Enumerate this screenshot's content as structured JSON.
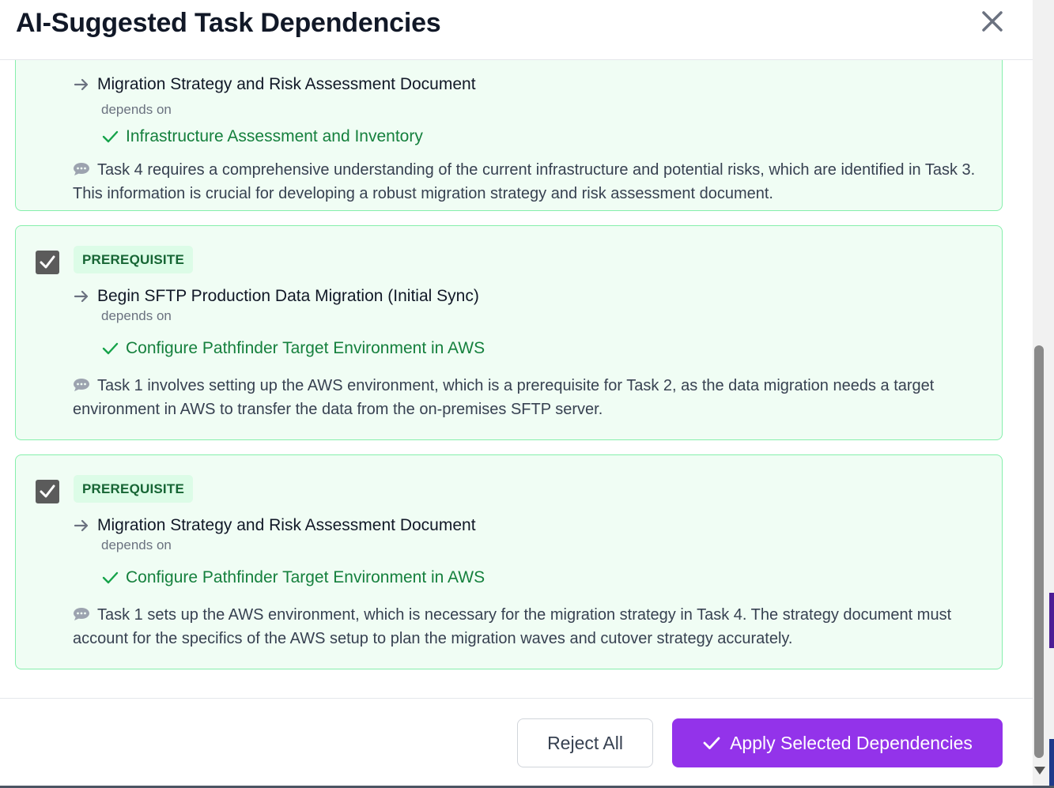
{
  "modal": {
    "title": "AI-Suggested Task Dependencies",
    "close_icon": "close-icon"
  },
  "suggestions": [
    {
      "checked": true,
      "badge": "",
      "task": "Migration Strategy and Risk Assessment Document",
      "depends_label": "depends on",
      "dependency": "Infrastructure Assessment and Inventory",
      "reason": "Task 4 requires a comprehensive understanding of the current infrastructure and potential risks, which are identified in Task 3. This information is crucial for developing a robust migration strategy and risk assessment document."
    },
    {
      "checked": true,
      "badge": "PREREQUISITE",
      "task": "Begin SFTP Production Data Migration (Initial Sync)",
      "depends_label": "depends on",
      "dependency": "Configure Pathfinder Target Environment in AWS",
      "reason": "Task 1 involves setting up the AWS environment, which is a prerequisite for Task 2, as the data migration needs a target environment in AWS to transfer the data from the on-premises SFTP server."
    },
    {
      "checked": true,
      "badge": "PREREQUISITE",
      "task": "Migration Strategy and Risk Assessment Document",
      "depends_label": "depends on",
      "dependency": "Configure Pathfinder Target Environment in AWS",
      "reason": "Task 1 sets up the AWS environment, which is necessary for the migration strategy in Task 4. The strategy document must account for the specifics of the AWS setup to plan the migration waves and cutover strategy accurately."
    }
  ],
  "footer": {
    "reject_label": "Reject All",
    "apply_label": "Apply Selected Dependencies"
  },
  "colors": {
    "accent": "#9333ea",
    "card_bg": "#f0fdf4",
    "card_border": "#86efac",
    "dependency_text": "#15803d",
    "badge_bg": "#dcfce7"
  },
  "icons": [
    "close-icon",
    "checkbox-checked-icon",
    "arrow-right-icon",
    "check-icon",
    "chat-bubble-icon"
  ]
}
